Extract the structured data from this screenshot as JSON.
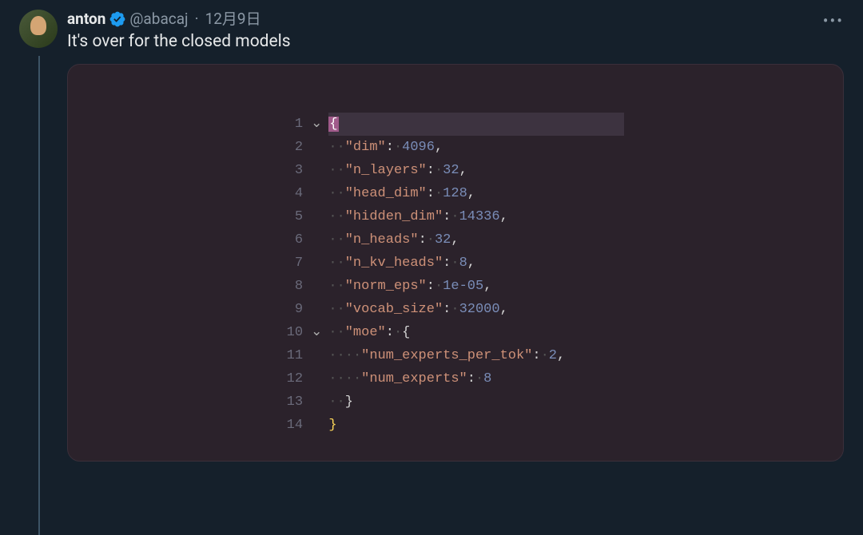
{
  "tweet": {
    "author": {
      "display_name": "anton",
      "handle": "@abacaj",
      "verified": true
    },
    "timestamp": "12月9日",
    "text": "It's over for the closed models",
    "more_label": "•••"
  },
  "code": {
    "line_numbers": [
      "1",
      "2",
      "3",
      "4",
      "5",
      "6",
      "7",
      "8",
      "9",
      "10",
      "11",
      "12",
      "13",
      "14"
    ],
    "fold_markers": {
      "l1": "⌄",
      "l10": "⌄"
    },
    "json_config": {
      "dim": 4096,
      "n_layers": 32,
      "head_dim": 128,
      "hidden_dim": 14336,
      "n_heads": 32,
      "n_kv_heads": 8,
      "norm_eps": "1e-05",
      "vocab_size": 32000,
      "moe": {
        "num_experts_per_tok": 2,
        "num_experts": 8
      }
    },
    "keys": {
      "dim": "\"dim\"",
      "n_layers": "\"n_layers\"",
      "head_dim": "\"head_dim\"",
      "hidden_dim": "\"hidden_dim\"",
      "n_heads": "\"n_heads\"",
      "n_kv_heads": "\"n_kv_heads\"",
      "norm_eps": "\"norm_eps\"",
      "vocab_size": "\"vocab_size\"",
      "moe": "\"moe\"",
      "num_experts_per_tok": "\"num_experts_per_tok\"",
      "num_experts": "\"num_experts\""
    },
    "punct": {
      "colon_sp": ": ",
      "comma": ",",
      "brace_open": "{",
      "brace_close": "}",
      "dot": "·"
    }
  }
}
